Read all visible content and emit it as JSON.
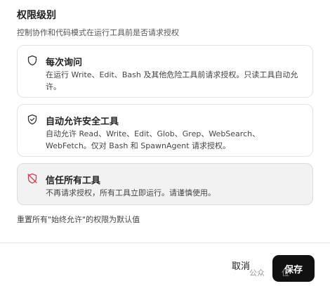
{
  "section": {
    "title": "权限级别",
    "subtitle": "控制协作和代码模式在运行工具前是否请求授权"
  },
  "options": [
    {
      "label": "每次询问",
      "description": "在运行 Write、Edit、Bash 及其他危险工具前请求授权。只读工具自动允许。",
      "icon": "shield-icon",
      "selected": false
    },
    {
      "label": "自动允许安全工具",
      "description": "自动允许 Read、Write、Edit、Glob、Grep、WebSearch、WebFetch。仅对 Bash 和 SpawnAgent 请求授权。",
      "icon": "shield-check-icon",
      "selected": false
    },
    {
      "label": "信任所有工具",
      "description": "不再请求授权，所有工具立即运行。请谨慎使用。",
      "icon": "shield-off-icon",
      "selected": true
    }
  ],
  "reset_link": "重置所有\"始终允许\"的权限为默认值",
  "footer": {
    "cancel_label": "取消",
    "save_label": "保存"
  },
  "watermark": {
    "text": "公众",
    "tail": "位"
  },
  "colors": {
    "save_bg": "#111111",
    "selected_bg": "#f2f2f2",
    "danger_icon": "#c8434f"
  }
}
